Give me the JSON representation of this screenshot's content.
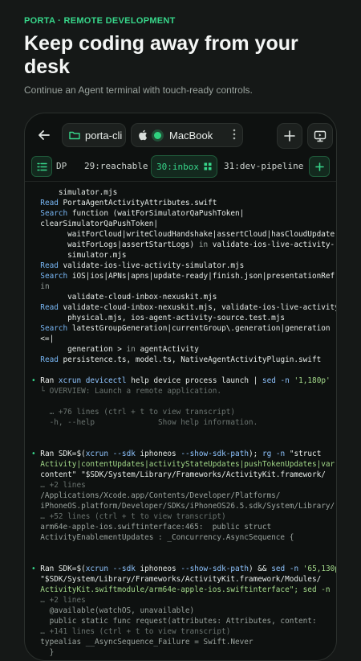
{
  "header": {
    "eyebrow": "PORTA · REMOTE DEVELOPMENT",
    "headline": "Keep coding away from your desk",
    "subline": "Continue an Agent terminal with touch-ready controls."
  },
  "topbar": {
    "host": "porta-cli",
    "machine": "MacBook",
    "status": "connected"
  },
  "tabs": {
    "first_label": "DP",
    "items": [
      "29:reachable",
      "30:inbox",
      "31:dev-pipeline"
    ],
    "active_index": 1
  },
  "terminal": {
    "lines": [
      "      simulator.mjs",
      "  Read PortaAgentActivityAttributes.swift",
      "  Search function (waitForSimulatorQaPushToken|",
      "  clearSimulatorQaPushToken|",
      "        waitForCloud|writeCloudHandshake|assertCloud|hasCloudUpdate|",
      "        waitForLogs|assertStartLogs) in validate-ios-live-activity-",
      "        simulator.mjs",
      "  Read validate-ios-live-activity-simulator.mjs",
      "  Search iOS|ios|APNs|apns|update-ready|finish.json|presentationRef",
      "  in",
      "        validate-cloud-inbox-nexuskit.mjs",
      "  Read validate-cloud-inbox-nexuskit.mjs, validate-ios-live-activity-",
      "        physical.mjs, ios-agent-activity-source.test.mjs",
      "  Search latestGroupGeneration|currentGroup\\.generation|generation",
      "  <=|",
      "        generation > in agentActivity",
      "  Read persistence.ts, model.ts, NativeAgentActivityPlugin.swift",
      "",
      "• Ran xcrun devicectl help device process launch | sed -n '1,180p'",
      "  └ OVERVIEW: Launch a remote application.",
      "",
      "    … +76 lines (ctrl + t to view transcript)",
      "    -h, --help              Show help information.",
      "",
      "",
      "• Ran SDK=$(xcrun --sdk iphoneos --show-sdk-path); rg -n \"struct",
      "  Activity|contentUpdates|activityStateUpdates|pushTokenUpdates|var",
      "  content\" \"$SDK/System/Library/Frameworks/ActivityKit.framework/",
      "  … +2 lines",
      "  /Applications/Xcode.app/Contents/Developer/Platforms/",
      "  iPhoneOS.platform/Developer/SDKs/iPhoneOS26.5.sdk/System/Library/",
      "  … +52 lines (ctrl + t to view transcript)",
      "  arm64e-apple-ios.swiftinterface:465:  public struct",
      "  ActivityEnablementUpdates : _Concurrency.AsyncSequence {",
      "",
      "",
      "• Ran SDK=$(xcrun --sdk iphoneos --show-sdk-path) && sed -n '65,130p'",
      "  \"$SDK/System/Library/Frameworks/ActivityKit.framework/Modules/",
      "  ActivityKit.swiftmodule/arm64e-apple-ios.swiftinterface\"; sed -n",
      "  … +2 lines",
      "    @available(watchOS, unavailable)",
      "    public static func request(attributes: Attributes, content:",
      "  … +141 lines (ctrl + t to view transcript)",
      "  typealias __AsyncSequence_Failure = Swift.Never",
      "    }"
    ]
  },
  "colors": {
    "accent": "#37d68a",
    "background": "#151817",
    "panel": "#0e1110",
    "link": "#78b7f5",
    "string": "#a3d98a"
  },
  "icons": [
    "back-arrow-icon",
    "folder-icon",
    "apple-icon",
    "more-vertical-icon",
    "plus-icon",
    "monitor-icon",
    "sidebar-icon",
    "grid-icon"
  ]
}
